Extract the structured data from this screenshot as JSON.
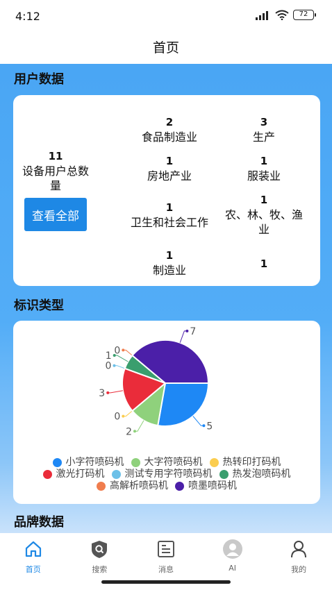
{
  "status_bar": {
    "time": "4:12",
    "battery": "72"
  },
  "header": {
    "title": "首页"
  },
  "user_data": {
    "section_title": "用户数据",
    "total": {
      "value": "11",
      "label": "设备用户总数量"
    },
    "view_all_label": "查看全部",
    "industries": [
      {
        "value": "2",
        "label": "食品制造业"
      },
      {
        "value": "3",
        "label": "生产"
      },
      {
        "value": "1",
        "label": "房地产业"
      },
      {
        "value": "1",
        "label": "服装业"
      },
      {
        "value": "1",
        "label": "卫生和社会工作"
      },
      {
        "value": "1",
        "label": "农、林、牧、渔业"
      },
      {
        "value": "1",
        "label": "制造业"
      },
      {
        "value": "1",
        "label": ""
      }
    ]
  },
  "mark_types": {
    "section_title": "标识类型",
    "legend": [
      {
        "label": "小字符喷码机",
        "color": "#1e88f5"
      },
      {
        "label": "大字符喷码机",
        "color": "#8fd17c"
      },
      {
        "label": "热转印打码机",
        "color": "#fbcd4f"
      },
      {
        "label": "激光打码机",
        "color": "#ea2c3a"
      },
      {
        "label": "测试专用字符喷码机",
        "color": "#6cc0e8"
      },
      {
        "label": "热发泡喷码机",
        "color": "#3a9e6e"
      },
      {
        "label": "高解析喷码机",
        "color": "#f07d4e"
      },
      {
        "label": "喷墨喷码机",
        "color": "#4b1fa8"
      }
    ]
  },
  "chart_data": {
    "type": "pie",
    "categories": [
      "小字符喷码机",
      "大字符喷码机",
      "热转印打码机",
      "激光打码机",
      "测试专用字符喷码机",
      "热发泡喷码机",
      "高解析喷码机",
      "喷墨喷码机"
    ],
    "values": [
      5,
      2,
      0,
      3,
      0,
      1,
      0,
      7
    ],
    "colors": [
      "#1e88f5",
      "#8fd17c",
      "#fbcd4f",
      "#ea2c3a",
      "#6cc0e8",
      "#3a9e6e",
      "#f07d4e",
      "#4b1fa8"
    ],
    "legend_position": "bottom"
  },
  "brand_data": {
    "section_title": "品牌数据"
  },
  "tab_bar": {
    "tabs": [
      {
        "label": "首页",
        "icon": "home-icon",
        "active": true
      },
      {
        "label": "搜索",
        "icon": "search-icon",
        "active": false
      },
      {
        "label": "消息",
        "icon": "message-icon",
        "active": false
      },
      {
        "label": "AI",
        "icon": "ai-icon",
        "active": false
      },
      {
        "label": "我的",
        "icon": "profile-icon",
        "active": false
      }
    ]
  }
}
